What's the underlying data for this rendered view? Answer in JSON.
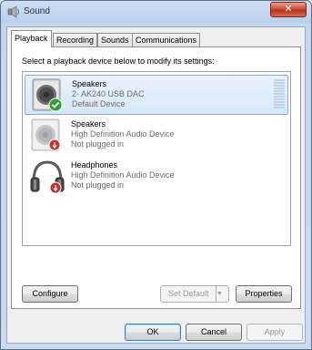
{
  "window": {
    "title": "Sound",
    "close_label": "✕"
  },
  "tabs": [
    {
      "label": "Playback",
      "active": true
    },
    {
      "label": "Recording"
    },
    {
      "label": "Sounds"
    },
    {
      "label": "Communications"
    }
  ],
  "instruction": "Select a playback device below to modify its settings:",
  "devices": [
    {
      "name": "Speakers",
      "description": "2- AK240 USB DAC",
      "status": "Default Device",
      "icon": "speaker-icon",
      "badge": "default-check-icon",
      "selected": true
    },
    {
      "name": "Speakers",
      "description": "High Definition Audio Device",
      "status": "Not plugged in",
      "icon": "speaker-icon",
      "badge": "unplugged-icon"
    },
    {
      "name": "Headphones",
      "description": "High Definition Audio Device",
      "status": "Not plugged in",
      "icon": "headphones-icon",
      "badge": "unplugged-icon"
    }
  ],
  "buttons": {
    "configure": "Configure",
    "set_default": "Set Default",
    "properties": "Properties",
    "ok": "OK",
    "cancel": "Cancel",
    "apply": "Apply"
  },
  "colors": {
    "selection": "#d6e8f8",
    "selection_border": "#84acdd",
    "check": "#2fa12f",
    "unplugged": "#c8302a"
  }
}
